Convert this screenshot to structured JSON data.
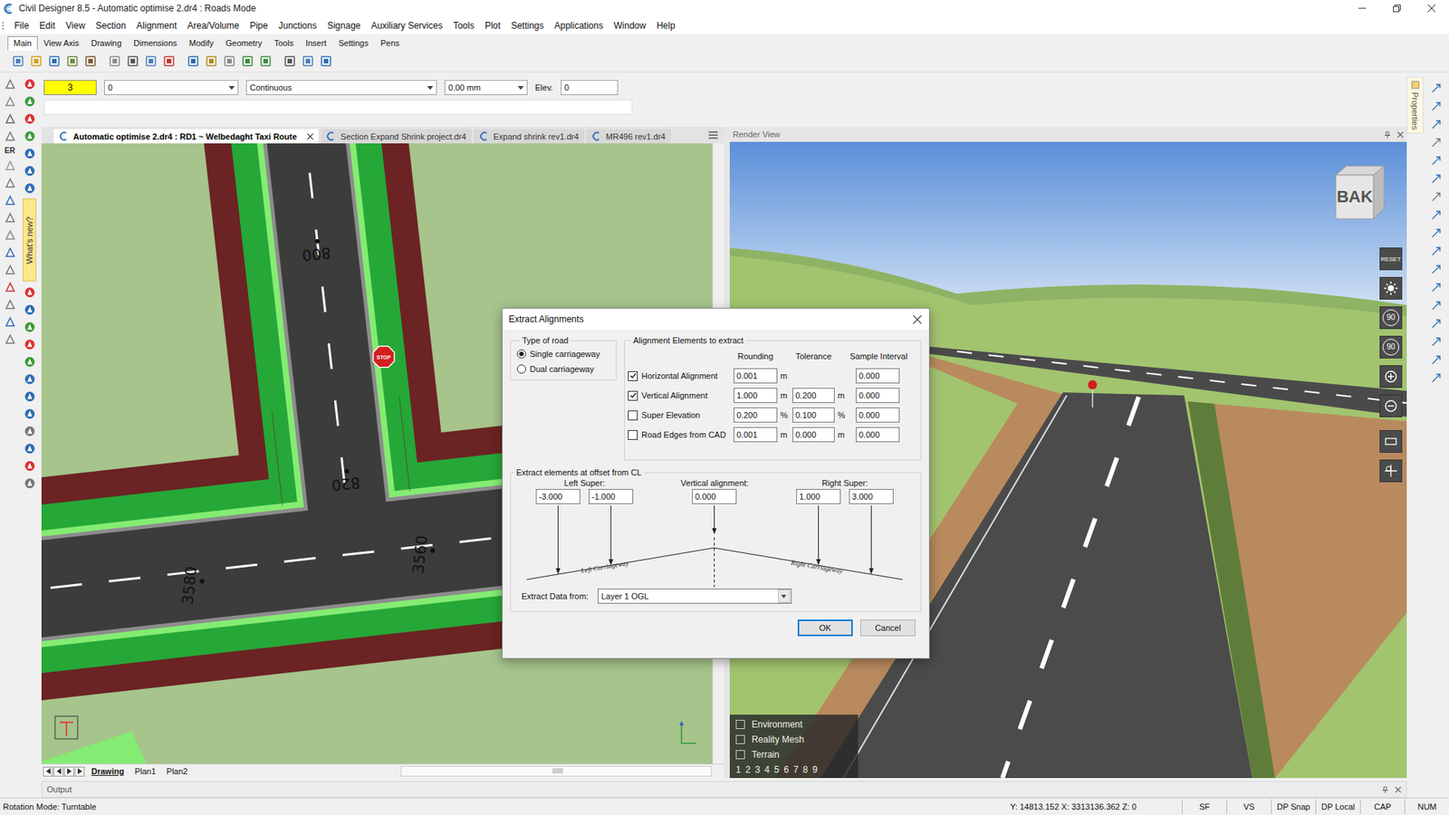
{
  "window": {
    "title": "Civil Designer 8.5 - Automatic optimise 2.dr4 : Roads Mode"
  },
  "menu": [
    "File",
    "Edit",
    "View",
    "Section",
    "Alignment",
    "Area/Volume",
    "Pipe",
    "Junctions",
    "Signage",
    "Auxiliary Services",
    "Tools",
    "Plot",
    "Settings",
    "Applications",
    "Window",
    "Help"
  ],
  "ribbon_tabs": [
    {
      "label": "Main",
      "selected": true
    },
    {
      "label": "View Axis",
      "selected": false
    },
    {
      "label": "Drawing",
      "selected": false
    },
    {
      "label": "Dimensions",
      "selected": false
    },
    {
      "label": "Modify",
      "selected": false
    },
    {
      "label": "Geometry",
      "selected": false
    },
    {
      "label": "Tools",
      "selected": false
    },
    {
      "label": "Insert",
      "selected": false
    },
    {
      "label": "Settings",
      "selected": false
    },
    {
      "label": "Pens",
      "selected": false
    }
  ],
  "properties_bar": {
    "color": "3",
    "layer": "0",
    "linetype": "Continuous",
    "lineweight": "0.00 mm",
    "elevation_label": "Elev.",
    "elevation": "0"
  },
  "left_toolbar": {
    "label": "ER",
    "whats_new": "What's new?"
  },
  "document_tabs": [
    {
      "label": "Automatic optimise 2.dr4 : RD1 ~ Welbedaght Taxi Route",
      "selected": true
    },
    {
      "label": "Section Expand Shrink project.dr4",
      "selected": false
    },
    {
      "label": "Expand shrink rev1.dr4",
      "selected": false
    },
    {
      "label": "MR496 rev1.dr4",
      "selected": false
    }
  ],
  "drawing": {
    "chainages": [
      "800",
      "820",
      "3580",
      "3560"
    ],
    "stop_sign": "STOP"
  },
  "sheet_tabs": [
    {
      "label": "Drawing",
      "selected": true
    },
    {
      "label": "Plan1",
      "selected": false
    },
    {
      "label": "Plan2",
      "selected": false
    }
  ],
  "render_view": {
    "title": "Render View",
    "cube_face": "BAK",
    "reset": "RESET",
    "rotate_buttons": [
      "90",
      "90"
    ],
    "layers": [
      {
        "label": "Environment",
        "checked": false
      },
      {
        "label": "Reality Mesh",
        "checked": false
      },
      {
        "label": "Terrain",
        "checked": false
      }
    ],
    "views": [
      "1",
      "2",
      "3",
      "4",
      "5",
      "6",
      "7",
      "8",
      "9"
    ]
  },
  "properties_panel": {
    "tab": "Properties"
  },
  "output": {
    "title": "Output"
  },
  "status_bar": {
    "mode": "Rotation Mode: Turntable",
    "coordinates": "Y: 14813.152 X: 3313136.362 Z: 0",
    "indicators": [
      "SF",
      "VS",
      "DP Snap",
      "DP Local",
      "CAP",
      "NUM"
    ]
  },
  "dialog": {
    "title": "Extract Alignments",
    "road_type": {
      "legend": "Type of road",
      "options": [
        {
          "label": "Single carriageway",
          "selected": true
        },
        {
          "label": "Dual carriageway",
          "selected": false
        }
      ]
    },
    "elements": {
      "legend": "Alignment Elements to extract",
      "headers": [
        "Rounding",
        "Tolerance",
        "Sample Interval"
      ],
      "rows": [
        {
          "label": "Horizontal Alignment",
          "checked": true,
          "rounding": "0.001",
          "rounding_unit": "m",
          "sample": "0.000"
        },
        {
          "label": "Vertical Alignment",
          "checked": true,
          "rounding": "1.000",
          "rounding_unit": "m",
          "tolerance": "0.200",
          "tolerance_unit": "m",
          "sample": "0.000"
        },
        {
          "label": "Super Elevation",
          "checked": false,
          "rounding": "0.200",
          "rounding_unit": "%",
          "tolerance": "0.100",
          "tolerance_unit": "%",
          "sample": "0.000"
        },
        {
          "label": "Road Edges from CAD",
          "checked": false,
          "rounding": "0.001",
          "rounding_unit": "m",
          "tolerance": "0.000",
          "tolerance_unit": "m",
          "sample": "0.000"
        }
      ]
    },
    "offsets": {
      "legend": "Extract elements at offset from CL",
      "left_label": "Left Super:",
      "left_values": [
        "-3.000",
        "-1.000"
      ],
      "vertical_label": "Vertical alignment:",
      "vertical_value": "0.000",
      "right_label": "Right Super:",
      "right_values": [
        "1.000",
        "3.000"
      ],
      "left_carriageway": "Left Carriageway",
      "right_carriageway": "Right Carriageway"
    },
    "source": {
      "label": "Extract Data from:",
      "value": "Layer 1 OGL"
    },
    "buttons": [
      {
        "label": "OK",
        "default": true
      },
      {
        "label": "Cancel",
        "default": false
      }
    ]
  }
}
